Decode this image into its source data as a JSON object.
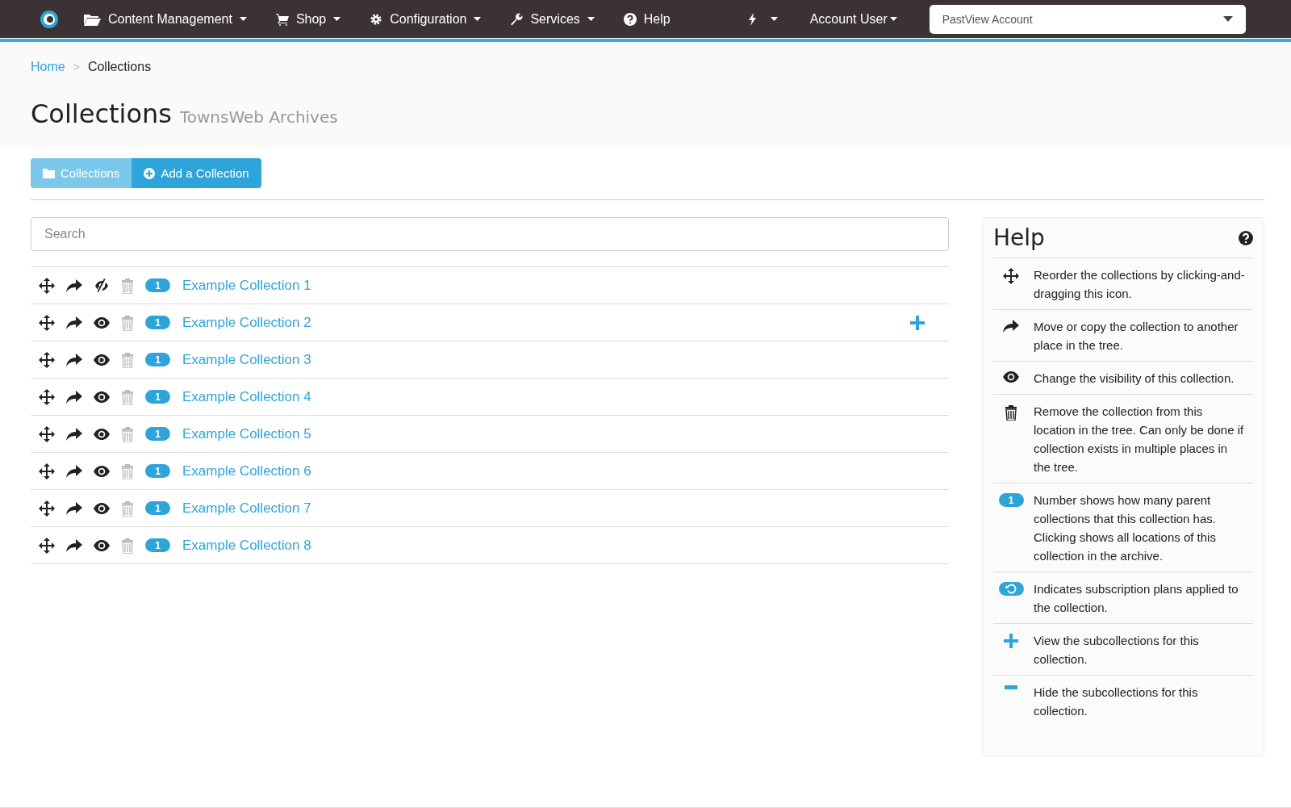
{
  "navbar": {
    "items": [
      {
        "label": "Content Management",
        "kind": "folder",
        "dropdown": true
      },
      {
        "label": "Shop",
        "kind": "cart",
        "dropdown": true
      },
      {
        "label": "Configuration",
        "kind": "gear",
        "dropdown": true
      },
      {
        "label": "Services",
        "kind": "wrench",
        "dropdown": true
      },
      {
        "label": "Help",
        "kind": "help",
        "dropdown": false
      }
    ],
    "user": "Account User",
    "account_select": {
      "value": "PastView Account"
    }
  },
  "breadcrumb": [
    {
      "label": "Home",
      "link": true
    },
    {
      "label": "Collections",
      "link": false
    }
  ],
  "breadcrumb_separator": ">",
  "page_title": "Collections",
  "page_subtitle": "TownsWeb Archives",
  "tabs": [
    {
      "label": "Collections",
      "kind": "folder",
      "selected": true
    },
    {
      "label": "Add a Collection",
      "kind": "add",
      "selected": false
    }
  ],
  "search": {
    "placeholder": "Search"
  },
  "collections": [
    {
      "name": "Example Collection 1",
      "count": "1",
      "visible": false,
      "has_children": false
    },
    {
      "name": "Example Collection 2",
      "count": "1",
      "visible": true,
      "has_children": true
    },
    {
      "name": "Example Collection 3",
      "count": "1",
      "visible": true,
      "has_children": false
    },
    {
      "name": "Example Collection 4",
      "count": "1",
      "visible": true,
      "has_children": false
    },
    {
      "name": "Example Collection 5",
      "count": "1",
      "visible": true,
      "has_children": false
    },
    {
      "name": "Example Collection 6",
      "count": "1",
      "visible": true,
      "has_children": false
    },
    {
      "name": "Example Collection 7",
      "count": "1",
      "visible": true,
      "has_children": false
    },
    {
      "name": "Example Collection 8",
      "count": "1",
      "visible": true,
      "has_children": false
    }
  ],
  "help": {
    "title": "Help",
    "items": [
      {
        "kind": "move",
        "text": "Reorder the collections by clicking-and-dragging this icon."
      },
      {
        "kind": "share",
        "text": "Move or copy the collection to another place in the tree."
      },
      {
        "kind": "eye",
        "text": "Change the visibility of this collection."
      },
      {
        "kind": "trash",
        "text": "Remove the collection from this location in the tree. Can only be done if collection exists in multiple places in the tree."
      },
      {
        "kind": "count",
        "badge": "1",
        "text": "Number shows how many parent collections that this collection has. Clicking shows all locations of this collection in the archive."
      },
      {
        "kind": "subscription",
        "text": "Indicates subscription plans applied to the collection."
      },
      {
        "kind": "plus",
        "text": "View the subcollections for this collection."
      },
      {
        "kind": "minus",
        "text": "Hide the subcollections for this collection."
      }
    ]
  }
}
